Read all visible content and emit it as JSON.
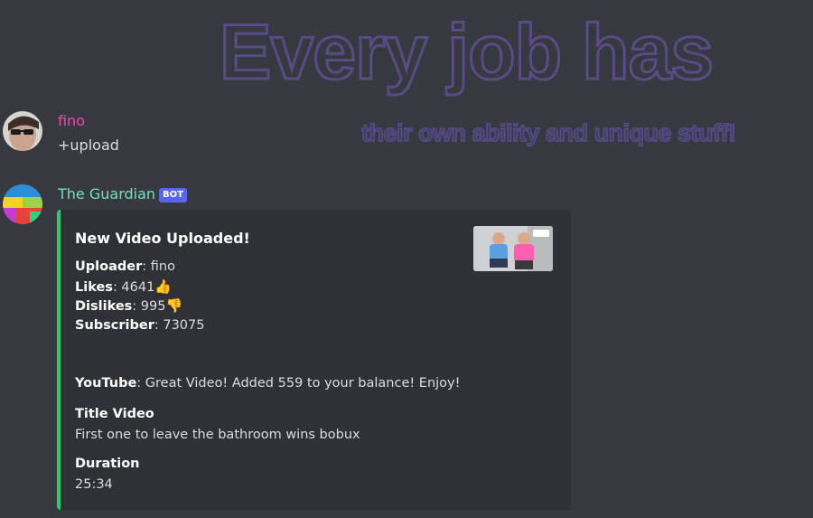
{
  "overlay": {
    "headline": "Every job has",
    "subline": "their own ability and unique stuff!"
  },
  "messages": [
    {
      "author": "fino",
      "author_color": "#e74cb3",
      "content": "+upload"
    },
    {
      "author": "The Guardian",
      "author_color": "#6ee2b7",
      "bot_tag": "BOT"
    }
  ],
  "embed": {
    "accent": "#2ecc71",
    "title": "New Video Uploaded!",
    "uploader_label": "Uploader",
    "uploader_value": ": fino",
    "likes_label": "Likes",
    "likes_value": ": 4641",
    "likes_icon": "thumbs-up-icon",
    "dislikes_label": "Dislikes",
    "dislikes_value": ": 995",
    "dislikes_icon": "thumbs-down-icon",
    "subscriber_label": "Subscriber",
    "subscriber_value": ": 73075",
    "youtube_label": "YouTube",
    "youtube_value": ": Great Video! Added 559 to your balance! Enjoy!",
    "fields": [
      {
        "name": "Title Video",
        "value": "First one to leave the bathroom wins bobux"
      },
      {
        "name": "Duration",
        "value": "25:34"
      }
    ]
  }
}
